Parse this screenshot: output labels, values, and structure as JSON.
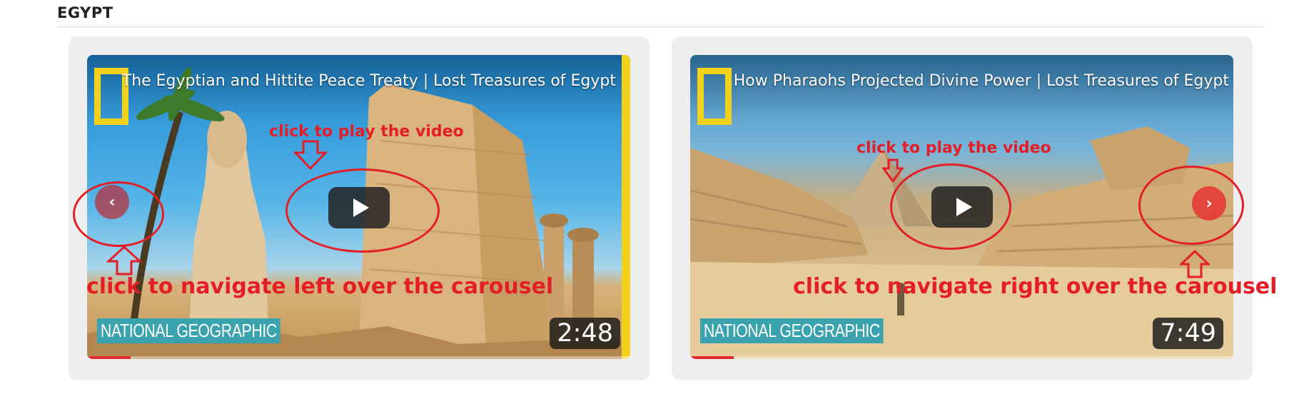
{
  "section": {
    "title": "EGYPT"
  },
  "videos": [
    {
      "title": "The Egyptian and Hittite Peace Treaty | Lost Treasures of Egypt",
      "brand": "NATIONAL GEOGRAPHIC",
      "duration": "2:48",
      "play_icon": "play-icon",
      "nav_label": "‹",
      "nav_icon": "chevron-left-icon"
    },
    {
      "title": "How Pharaohs Projected Divine Power | Lost Treasures of Egypt",
      "brand": "NATIONAL GEOGRAPHIC",
      "duration": "7:49",
      "play_icon": "play-icon",
      "nav_label": "›",
      "nav_icon": "chevron-right-icon"
    }
  ],
  "annotations": {
    "play_hint": "click to play the video",
    "nav_left_hint": "click to navigate left over the carousel",
    "nav_right_hint": "click to navigate right over the carousel"
  },
  "colors": {
    "annotation": "#e41e26",
    "natgeo_yellow": "#f3d21c",
    "brand_teal": "#3aa3ad",
    "card_bg": "#eeeeee"
  }
}
